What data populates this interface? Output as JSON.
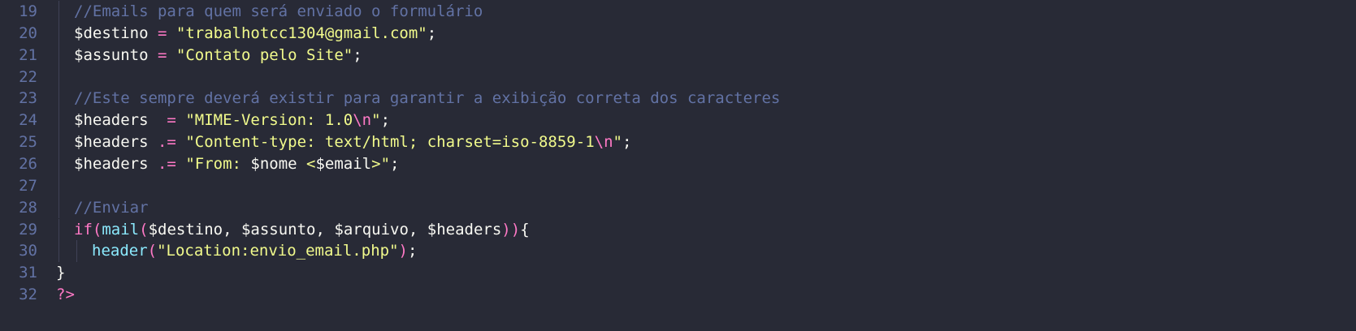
{
  "editor": {
    "colors": {
      "background": "#282a36",
      "line_number": "#6272a4",
      "comment": "#6272a4",
      "string": "#f1fa8c",
      "keyword": "#ff79c6",
      "function": "#8be9fd",
      "text": "#f8f8f2"
    },
    "lines": [
      {
        "number": "19",
        "indent": 1,
        "tokens": [
          {
            "t": "//Emails para quem será enviado o formulário",
            "c": "comment"
          }
        ]
      },
      {
        "number": "20",
        "indent": 1,
        "tokens": [
          {
            "t": "$destino",
            "c": "var"
          },
          {
            "t": " ",
            "c": "punc"
          },
          {
            "t": "=",
            "c": "op"
          },
          {
            "t": " ",
            "c": "punc"
          },
          {
            "t": "\"trabalhotcc1304@gmail.com\"",
            "c": "str"
          },
          {
            "t": ";",
            "c": "punc"
          }
        ]
      },
      {
        "number": "21",
        "indent": 1,
        "tokens": [
          {
            "t": "$assunto",
            "c": "var"
          },
          {
            "t": " ",
            "c": "punc"
          },
          {
            "t": "=",
            "c": "op"
          },
          {
            "t": " ",
            "c": "punc"
          },
          {
            "t": "\"Contato pelo Site\"",
            "c": "str"
          },
          {
            "t": ";",
            "c": "punc"
          }
        ]
      },
      {
        "number": "22",
        "indent": 1,
        "tokens": []
      },
      {
        "number": "23",
        "indent": 1,
        "tokens": [
          {
            "t": "//Este sempre deverá existir para garantir a exibição correta dos caracteres",
            "c": "comment"
          }
        ]
      },
      {
        "number": "24",
        "indent": 1,
        "tokens": [
          {
            "t": "$headers",
            "c": "var"
          },
          {
            "t": "  ",
            "c": "punc"
          },
          {
            "t": "=",
            "c": "op"
          },
          {
            "t": " ",
            "c": "punc"
          },
          {
            "t": "\"MIME-Version: 1.0",
            "c": "str"
          },
          {
            "t": "\\n",
            "c": "esc"
          },
          {
            "t": "\"",
            "c": "str"
          },
          {
            "t": ";",
            "c": "punc"
          }
        ]
      },
      {
        "number": "25",
        "indent": 1,
        "tokens": [
          {
            "t": "$headers",
            "c": "var"
          },
          {
            "t": " ",
            "c": "punc"
          },
          {
            "t": ".=",
            "c": "op"
          },
          {
            "t": " ",
            "c": "punc"
          },
          {
            "t": "\"Content-type: text/html; charset=iso-8859-1",
            "c": "str"
          },
          {
            "t": "\\n",
            "c": "esc"
          },
          {
            "t": "\"",
            "c": "str"
          },
          {
            "t": ";",
            "c": "punc"
          }
        ]
      },
      {
        "number": "26",
        "indent": 1,
        "tokens": [
          {
            "t": "$headers",
            "c": "var"
          },
          {
            "t": " ",
            "c": "punc"
          },
          {
            "t": ".=",
            "c": "op"
          },
          {
            "t": " ",
            "c": "punc"
          },
          {
            "t": "\"From: ",
            "c": "str"
          },
          {
            "t": "$nome",
            "c": "var"
          },
          {
            "t": " <",
            "c": "str"
          },
          {
            "t": "$email",
            "c": "var"
          },
          {
            "t": ">\"",
            "c": "str"
          },
          {
            "t": ";",
            "c": "punc"
          }
        ]
      },
      {
        "number": "27",
        "indent": 1,
        "tokens": []
      },
      {
        "number": "28",
        "indent": 1,
        "tokens": [
          {
            "t": "//Enviar",
            "c": "comment"
          }
        ]
      },
      {
        "number": "29",
        "indent": 1,
        "tokens": [
          {
            "t": "if",
            "c": "kw"
          },
          {
            "t": "(",
            "c": "paren"
          },
          {
            "t": "mail",
            "c": "fn"
          },
          {
            "t": "(",
            "c": "paren"
          },
          {
            "t": "$destino",
            "c": "var"
          },
          {
            "t": ", ",
            "c": "punc"
          },
          {
            "t": "$assunto",
            "c": "var"
          },
          {
            "t": ", ",
            "c": "punc"
          },
          {
            "t": "$arquivo",
            "c": "var"
          },
          {
            "t": ", ",
            "c": "punc"
          },
          {
            "t": "$headers",
            "c": "var"
          },
          {
            "t": ")",
            "c": "paren"
          },
          {
            "t": ")",
            "c": "paren"
          },
          {
            "t": "{",
            "c": "brace"
          }
        ]
      },
      {
        "number": "30",
        "indent": 2,
        "tokens": [
          {
            "t": "header",
            "c": "fn"
          },
          {
            "t": "(",
            "c": "paren"
          },
          {
            "t": "\"Location:envio_email.php\"",
            "c": "str"
          },
          {
            "t": ")",
            "c": "paren"
          },
          {
            "t": ";",
            "c": "punc"
          }
        ]
      },
      {
        "number": "31",
        "indent": 0,
        "tokens": [
          {
            "t": "}",
            "c": "brace"
          }
        ]
      },
      {
        "number": "32",
        "indent": 0,
        "tokens": [
          {
            "t": "?>",
            "c": "kw"
          }
        ]
      }
    ]
  }
}
